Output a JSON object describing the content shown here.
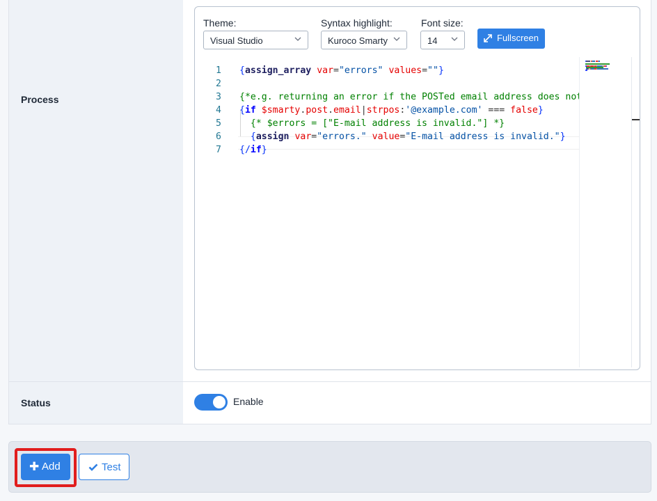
{
  "process": {
    "label": "Process",
    "controls": {
      "theme_label": "Theme:",
      "theme_value": "Visual Studio",
      "syntax_label": "Syntax highlight:",
      "syntax_value": "Kuroco Smarty",
      "font_size_label": "Font size:",
      "font_size_value": "14",
      "fullscreen_label": "Fullscreen"
    },
    "code_lines": [
      {
        "num": "1",
        "tokens": [
          [
            "brace",
            "{"
          ],
          [
            "kwp",
            "assign_array"
          ],
          [
            "op",
            " "
          ],
          [
            "attr",
            "var"
          ],
          [
            "op",
            "="
          ],
          [
            "str2",
            "\"errors\""
          ],
          [
            "op",
            " "
          ],
          [
            "attr",
            "values"
          ],
          [
            "op",
            "="
          ],
          [
            "str2",
            "\"\""
          ],
          [
            "brace",
            "}"
          ]
        ]
      },
      {
        "num": "2",
        "tokens": []
      },
      {
        "num": "3",
        "tokens": [
          [
            "cm",
            "{*e.g. returning an error if the POSTed email address does not m"
          ]
        ]
      },
      {
        "num": "4",
        "tokens": [
          [
            "brace",
            "{"
          ],
          [
            "kw",
            "if"
          ],
          [
            "op",
            " "
          ],
          [
            "var",
            "$smarty"
          ],
          [
            "op",
            "."
          ],
          [
            "var",
            "post"
          ],
          [
            "op",
            "."
          ],
          [
            "var",
            "email"
          ],
          [
            "op",
            "|"
          ],
          [
            "var",
            "strpos"
          ],
          [
            "op",
            ":"
          ],
          [
            "str2",
            "'@example.com'"
          ],
          [
            "op",
            " === "
          ],
          [
            "attr",
            "false"
          ],
          [
            "brace",
            "}"
          ]
        ]
      },
      {
        "num": "5",
        "tokens": [
          [
            "op",
            "  "
          ],
          [
            "cm",
            "{* $errors = [\"E-mail address is invalid.\"] *}"
          ]
        ]
      },
      {
        "num": "6",
        "tokens": [
          [
            "op",
            "  "
          ],
          [
            "brace",
            "{"
          ],
          [
            "kwp",
            "assign"
          ],
          [
            "op",
            " "
          ],
          [
            "attr",
            "var"
          ],
          [
            "op",
            "="
          ],
          [
            "str2",
            "\"errors.\""
          ],
          [
            "op",
            " "
          ],
          [
            "attr",
            "value"
          ],
          [
            "op",
            "="
          ],
          [
            "str2",
            "\"E-mail address is invalid.\""
          ],
          [
            "brace",
            "}"
          ]
        ]
      },
      {
        "num": "7",
        "tokens": [
          [
            "brace",
            "{/"
          ],
          [
            "kw",
            "if"
          ],
          [
            "brace",
            "}"
          ]
        ]
      }
    ]
  },
  "status": {
    "label": "Status",
    "toggle_label": "Enable",
    "enabled": true
  },
  "footer": {
    "add_label": "Add",
    "test_label": "Test"
  },
  "colors": {
    "accent": "#2f80e4",
    "highlight": "#e11d1d"
  }
}
